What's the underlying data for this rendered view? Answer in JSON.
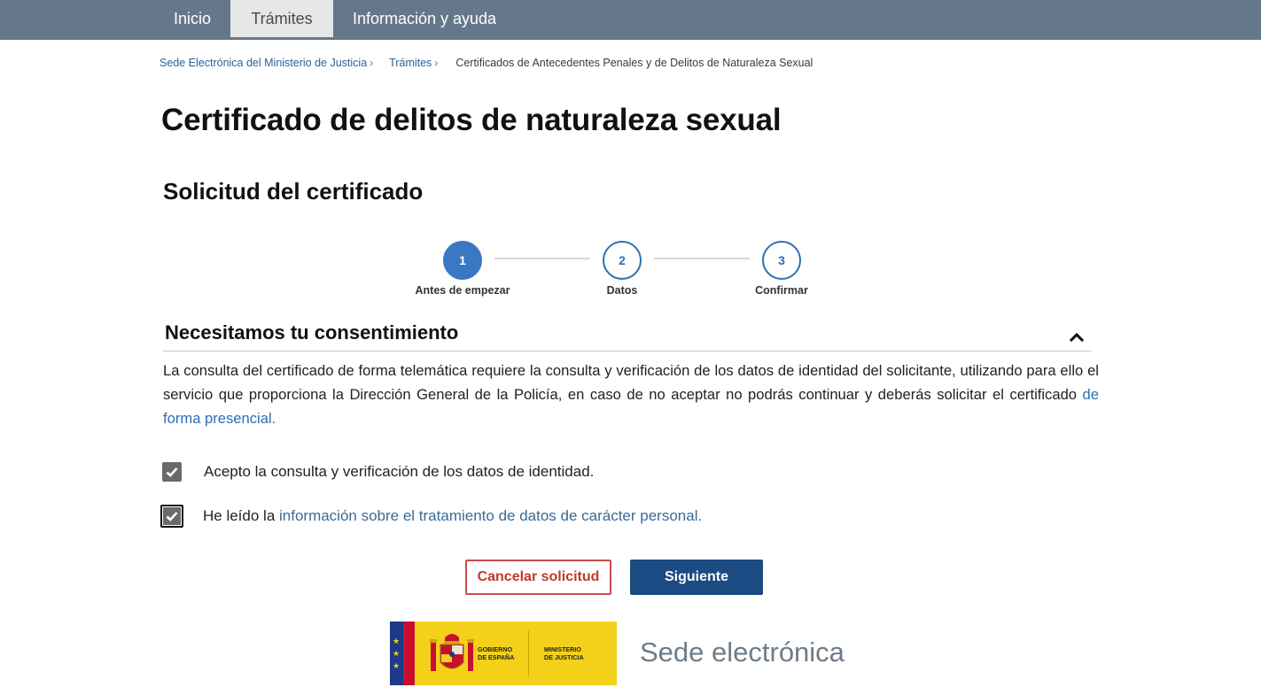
{
  "nav": {
    "tabs": [
      {
        "label": "Inicio"
      },
      {
        "label": "Trámites",
        "active": true
      },
      {
        "label": "Información y ayuda"
      }
    ],
    "bg_color": "#65788b"
  },
  "breadcrumb": {
    "items": [
      {
        "label": "Sede Electrónica del Ministerio de Justicia"
      },
      {
        "label": "Trámites"
      }
    ],
    "separator": "›",
    "current": "Certificados de Antecedentes Penales y de Delitos de Naturaleza Sexual"
  },
  "page": {
    "title": "Certificado de delitos de naturaleza sexual",
    "subtitle": "Solicitud del certificado"
  },
  "stepper": {
    "current_step": 1,
    "steps": [
      {
        "number": "1",
        "label": "Antes de empezar"
      },
      {
        "number": "2",
        "label": "Datos"
      },
      {
        "number": "3",
        "label": "Confirmar"
      }
    ]
  },
  "consent": {
    "title": "Necesitamos tu consentimiento",
    "expanded": true,
    "toggle_icon": "chevron-up-icon",
    "text": "La consulta del certificado de forma telemática requiere la consulta y verificación de los datos de identidad del solicitante, utilizando para ello el servicio que proporciona la Dirección General de la Policía, en caso de no aceptar no podrás continuar y deberás solicitar el certificado ",
    "text_link": "de forma presencial.",
    "checkboxes": [
      {
        "checked": true,
        "label": "Acepto la consulta y verificación de los datos de identidad."
      },
      {
        "checked": true,
        "label_prefix": "He leído la ",
        "label_link": "información sobre el tratamiento de datos de carácter personal."
      }
    ]
  },
  "actions": {
    "cancel_label": "Cancelar solicitud",
    "next_label": "Siguiente",
    "cancel_color": "#c0392b",
    "next_color": "#1c4a83"
  },
  "footer": {
    "logo": {
      "gobierno_line1": "GOBIERNO",
      "gobierno_line2": "DE ESPAÑA",
      "ministerio_line1": "MINISTERIO",
      "ministerio_line2": "DE JUSTICIA",
      "emblem_icon": "coat-of-arms-icon"
    },
    "sede_text": "Sede electrónica"
  }
}
